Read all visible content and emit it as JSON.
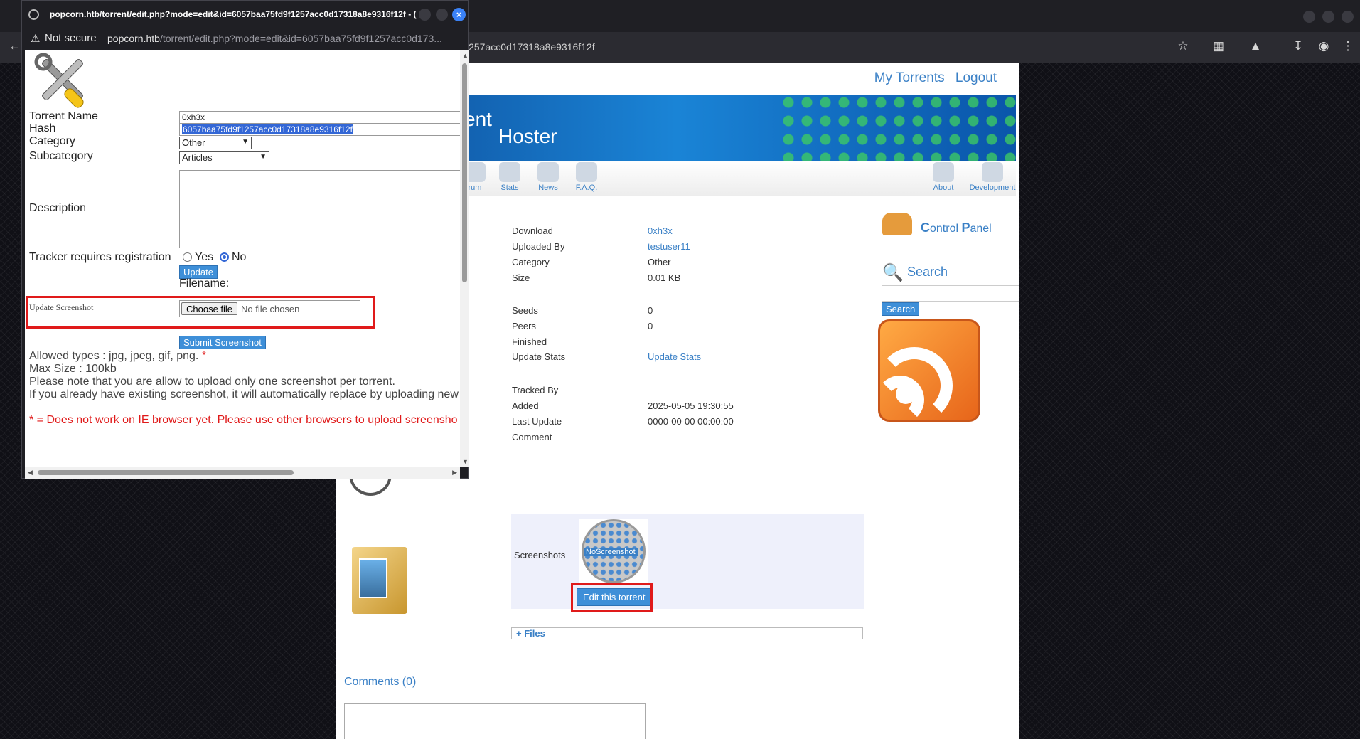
{
  "main_browser": {
    "address_visible": "l257acc0d17318a8e9316f12f"
  },
  "page": {
    "topnav": {
      "my_torrents": "My Torrents",
      "logout": "Logout"
    },
    "banner": {
      "text1": "ent",
      "text2": "Hoster"
    },
    "nav": [
      {
        "label": "rum"
      },
      {
        "label": "Stats"
      },
      {
        "label": "News"
      },
      {
        "label": "F.A.Q."
      },
      {
        "label": "About"
      },
      {
        "label": "Development"
      }
    ],
    "sidebar": {
      "control_panel_c": "C",
      "control_panel_1": "ontrol ",
      "control_panel_p": "P",
      "control_panel_2": "anel",
      "search_title": "Search",
      "search_button": "Search"
    },
    "details": [
      {
        "label": "Download",
        "value": "0xh3x",
        "link": true
      },
      {
        "label": "Uploaded By",
        "value": "testuser11",
        "link": true
      },
      {
        "label": "Category",
        "value": "Other",
        "link": false
      },
      {
        "label": "Size",
        "value": "0.01 KB",
        "link": false
      },
      {
        "label": "Seeds",
        "value": "0",
        "link": false
      },
      {
        "label": "Peers",
        "value": "0",
        "link": false
      },
      {
        "label": "Finished",
        "value": "",
        "link": false
      },
      {
        "label": "Update Stats",
        "value": "Update Stats",
        "link": true
      },
      {
        "label": "Tracked By",
        "value": "",
        "link": false
      },
      {
        "label": "Added",
        "value": "2025-05-05 19:30:55",
        "link": false
      },
      {
        "label": "Last Update",
        "value": "0000-00-00 00:00:00",
        "link": false
      },
      {
        "label": "Comment",
        "value": "",
        "link": false
      }
    ],
    "screenshots": {
      "label": "Screenshots",
      "no_screenshot_no": "No",
      "no_screenshot_text": "Screenshot",
      "edit_button": "Edit this torrent"
    },
    "files": "+ Files",
    "comments": "Comments (0)"
  },
  "popup": {
    "title": "popcorn.htb/torrent/edit.php?mode=edit&id=6057baa75fd9f1257acc0d17318a8e9316f12f - (",
    "not_secure": "Not secure",
    "url_host": "popcorn.htb",
    "url_rest": "/torrent/edit.php?mode=edit&id=6057baa75fd9f1257acc0d173...",
    "form": {
      "torrent_name_label": "Torrent Name",
      "torrent_name_value": "0xh3x",
      "hash_label": "Hash",
      "hash_value": "6057baa75fd9f1257acc0d17318a8e9316f12f",
      "category_label": "Category",
      "category_value": "Other",
      "subcategory_label": "Subcategory",
      "subcategory_value": "Articles",
      "description_label": "Description",
      "tracker_label": "Tracker requires registration",
      "yes_label": "Yes",
      "no_label": "No",
      "tracker_selected": "No",
      "update_button": "Update",
      "filename_label": "Filename:",
      "update_screenshot_label": "Update Screenshot",
      "choose_file_button": "Choose file",
      "no_file_chosen": "No file chosen",
      "submit_screenshot_button": "Submit Screenshot",
      "allowed_types": "Allowed types : jpg, jpeg, gif, png. ",
      "asterisk": "*",
      "max_size": "Max Size : 100kb",
      "note_one": "Please note that you are allow to upload only one screenshot per torrent.",
      "note_replace": "If you already have existing screenshot, it will automatically replace by uploading new",
      "ie_note": "* = Does not work on IE browser yet. Please use other browsers to upload screensho"
    }
  },
  "colors": {
    "link_blue": "#3a80c6",
    "button_blue": "#3e8fd8",
    "highlight_red": "#e01a1a"
  }
}
